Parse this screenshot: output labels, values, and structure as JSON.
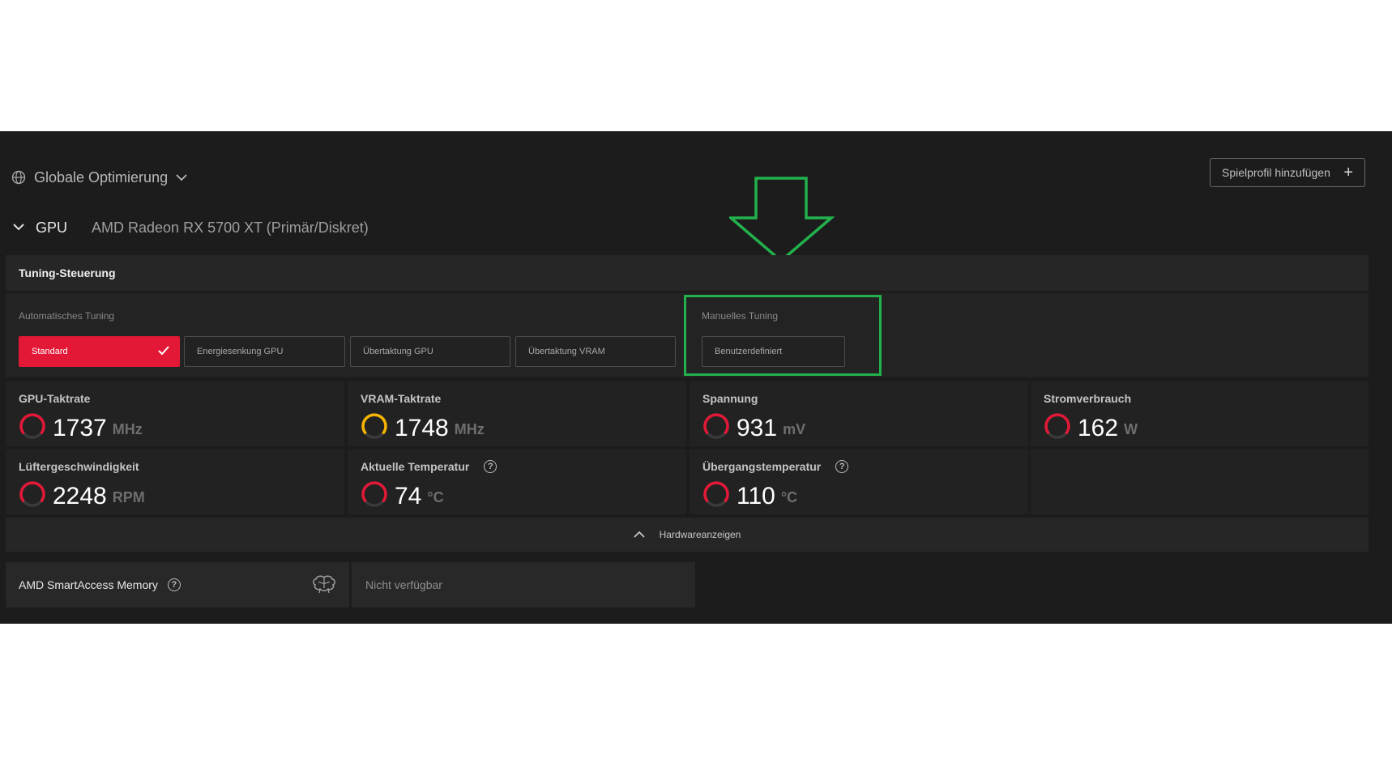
{
  "header": {
    "scope_label": "Globale Optimierung",
    "add_profile_label": "Spielprofil hinzufügen"
  },
  "gpu": {
    "label": "GPU",
    "name": "AMD Radeon RX 5700 XT (Primär/Diskret)"
  },
  "tuning": {
    "title": "Tuning-Steuerung",
    "auto_label": "Automatisches Tuning",
    "manual_label": "Manuelles Tuning",
    "buttons": [
      {
        "label": "Standard",
        "active": true
      },
      {
        "label": "Energiesenkung GPU",
        "active": false
      },
      {
        "label": "Übertaktung GPU",
        "active": false
      },
      {
        "label": "Übertaktung VRAM",
        "active": false
      }
    ],
    "custom_label": "Benutzerdefiniert"
  },
  "metrics": [
    {
      "label": "GPU-Taktrate",
      "value": "1737",
      "unit": "MHz",
      "gauge_color": "#e31837",
      "help": false
    },
    {
      "label": "VRAM-Taktrate",
      "value": "1748",
      "unit": "MHz",
      "gauge_color": "#f5b400",
      "help": false
    },
    {
      "label": "Spannung",
      "value": "931",
      "unit": "mV",
      "gauge_color": "#e31837",
      "help": false
    },
    {
      "label": "Stromverbrauch",
      "value": "162",
      "unit": "W",
      "gauge_color": "#e31837",
      "help": false
    },
    {
      "label": "Lüftergeschwindigkeit",
      "value": "2248",
      "unit": "RPM",
      "gauge_color": "#e31837",
      "help": false
    },
    {
      "label": "Aktuelle Temperatur",
      "value": "74",
      "unit": "°C",
      "gauge_color": "#e31837",
      "help": true
    },
    {
      "label": "Übergangstemperatur",
      "value": "110",
      "unit": "°C",
      "gauge_color": "#e31837",
      "help": true
    }
  ],
  "hardware_bar": {
    "label": "Hardwareanzeigen"
  },
  "smart_access": {
    "label": "AMD SmartAccess Memory",
    "status": "Nicht verfügbar"
  },
  "colors": {
    "accent": "#e31837",
    "highlight": "#22b14c",
    "background": "#1c1c1c"
  },
  "icons": [
    "globe-icon",
    "chevron-down-icon",
    "plus-icon",
    "check-icon",
    "help-icon",
    "chevron-up-icon",
    "brain-icon",
    "down-arrow-annotation"
  ]
}
